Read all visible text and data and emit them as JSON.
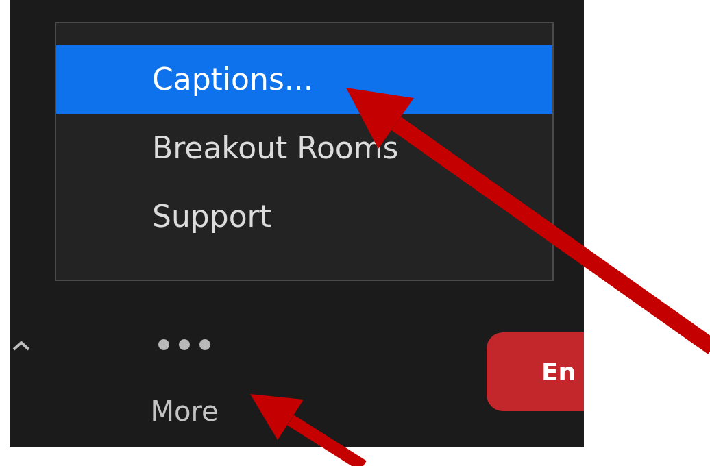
{
  "menu": {
    "items": [
      {
        "label": "Captions...",
        "selected": true
      },
      {
        "label": "Breakout Rooms",
        "selected": false
      },
      {
        "label": "Support",
        "selected": false
      }
    ]
  },
  "toolbar": {
    "more_button": {
      "label": "More"
    },
    "end_button": {
      "label": "En"
    }
  }
}
